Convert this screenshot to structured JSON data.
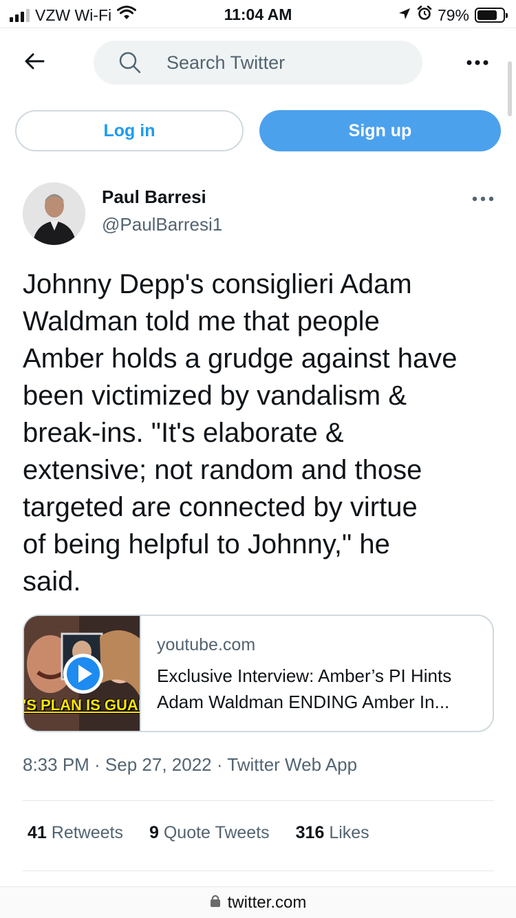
{
  "status_bar": {
    "carrier": "VZW Wi-Fi",
    "time": "11:04 AM",
    "battery": "79%",
    "battery_level": 0.79,
    "icons": [
      "cell-signal-icon",
      "wifi-icon",
      "location-arrow-icon",
      "alarm-icon",
      "battery-icon"
    ]
  },
  "topbar": {
    "back_icon": "arrow-left-icon",
    "search_placeholder": "Search Twitter",
    "more_icon": "more-horizontal-icon"
  },
  "auth": {
    "login_label": "Log in",
    "signup_label": "Sign up"
  },
  "tweet": {
    "author_name": "Paul Barresi",
    "author_handle": "@PaulBarresi1",
    "text": "Johnny Depp's consiglieri Adam\nWaldman told me that people\nAmber holds a grudge against have\nbeen victimized by vandalism &\nbreak-ins. \"It's elaborate &\nextensive; not random and those\ntargeted are connected by virtue\nof being helpful to Johnny,\" he\nsaid.",
    "card": {
      "domain": "youtube.com",
      "title": "Exclusive Interview: Amber’s PI Hints Adam Waldman ENDING Amber In...",
      "thumb_caption": "'S PLAN IS GUARANTEI"
    },
    "meta": "8:33 PM · Sep 27, 2022 · Twitter Web App",
    "stats": {
      "retweets_count": "41",
      "retweets_label": "Retweets",
      "quotes_count": "9",
      "quotes_label": "Quote Tweets",
      "likes_count": "316",
      "likes_label": "Likes"
    }
  },
  "urlbar": {
    "url": "twitter.com"
  },
  "colors": {
    "accent": "#1d9bf0",
    "signup_bg": "#4ca1ed",
    "secondary_text": "#536471",
    "border": "#cfd9de"
  }
}
